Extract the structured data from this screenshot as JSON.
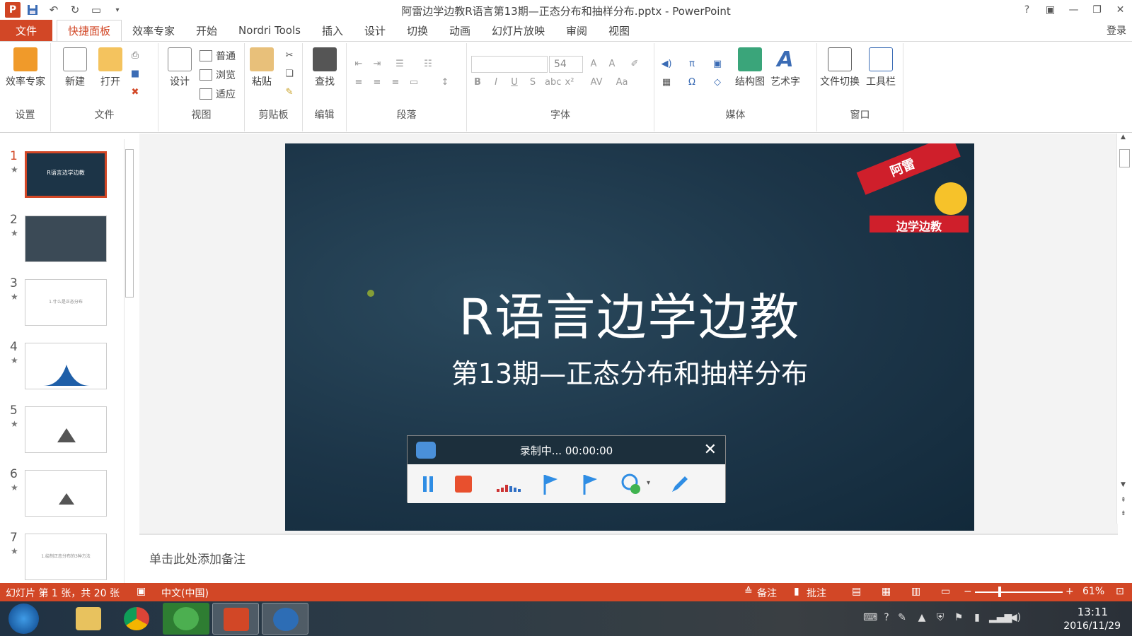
{
  "window": {
    "title": "阿雷边学边教R语言第13期—正态分布和抽样分布.pptx - PowerPoint",
    "help": "?",
    "login": "登录"
  },
  "menu": {
    "file": "文件",
    "tabs": [
      "快捷面板",
      "效率专家",
      "开始",
      "Nordri Tools",
      "插入",
      "设计",
      "切换",
      "动画",
      "幻灯片放映",
      "审阅",
      "视图"
    ]
  },
  "ribbon": {
    "groups": {
      "settings": "设置",
      "file": "文件",
      "view": "视图",
      "clipboard": "剪贴板",
      "edit": "编辑",
      "paragraph": "段落",
      "font": "字体",
      "media": "媒体",
      "window": "窗口"
    },
    "buttons": {
      "efficiency": "效率专家",
      "new": "新建",
      "open": "打开",
      "design": "设计",
      "normal": "普通",
      "browse": "浏览",
      "fit": "适应",
      "paste": "粘贴",
      "find": "查找",
      "structure": "结构图",
      "wordart": "艺术字",
      "fileswitch": "文件切换",
      "toolbar": "工具栏"
    },
    "font_size": "54"
  },
  "thumbnails": [
    {
      "num": "1",
      "text": "R语言边学边教"
    },
    {
      "num": "2",
      "text": ""
    },
    {
      "num": "3",
      "text": "1.什么是正态分布"
    },
    {
      "num": "4",
      "text": ""
    },
    {
      "num": "5",
      "text": ""
    },
    {
      "num": "6",
      "text": ""
    },
    {
      "num": "7",
      "text": "1.绘制正态分布的3种方法"
    }
  ],
  "slide": {
    "title": "R语言边学边教",
    "subtitle": "第13期—正态分布和抽样分布",
    "stamp_top": "阿雷",
    "stamp_bottom": "边学边教"
  },
  "recorder": {
    "status": "录制中... 00:00:00"
  },
  "notes": {
    "placeholder": "单击此处添加备注"
  },
  "statusbar": {
    "slide_info": "幻灯片 第 1 张，共 20 张",
    "language": "中文(中国)",
    "notes": "备注",
    "comments": "批注",
    "zoom_minus": "−",
    "zoom_plus": "+",
    "zoom": "61%"
  },
  "taskbar": {
    "time": "13:11",
    "date": "2016/11/29"
  },
  "colors": {
    "accent": "#d24726",
    "slide_bg": "#1c3548",
    "stamp_red": "#cf1f2b",
    "stamp_sun": "#f6c22a"
  }
}
